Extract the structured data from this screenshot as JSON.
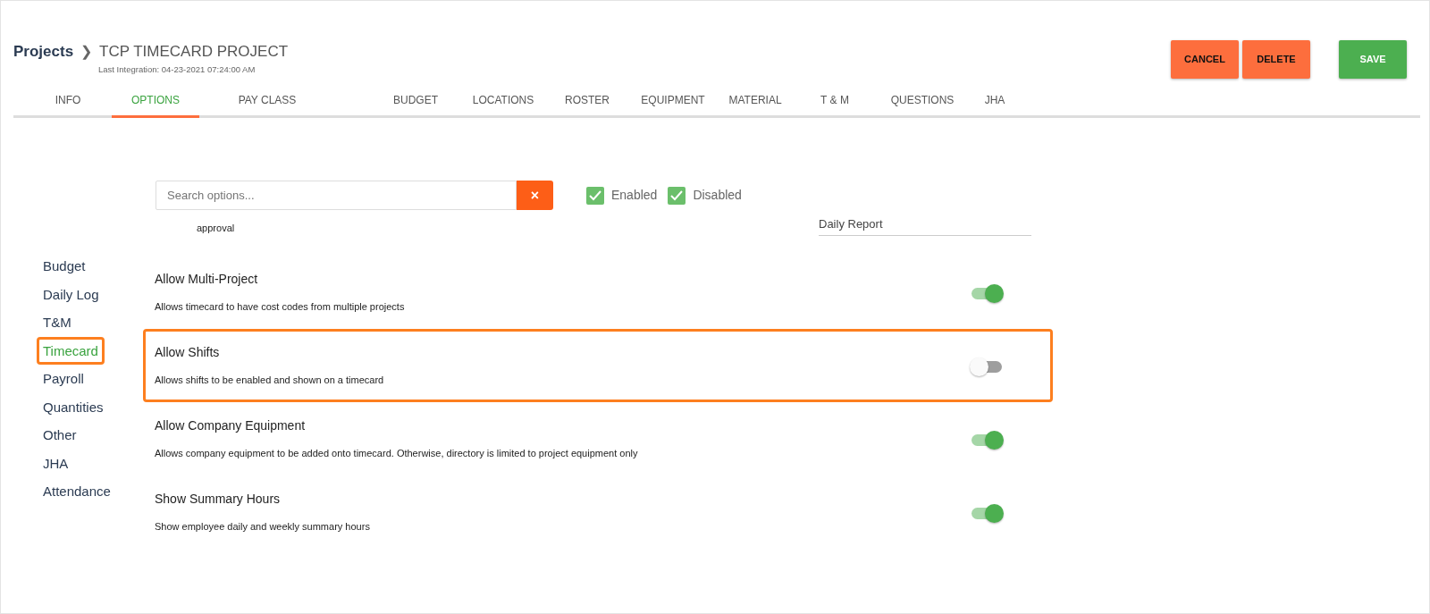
{
  "breadcrumb": {
    "root": "Projects",
    "separator": "❯",
    "project": "TCP TIMECARD PROJECT",
    "subtitle": "Last Integration: 04-23-2021 07:24:00 AM"
  },
  "actions": [
    {
      "label": "CANCEL",
      "kind": "warning"
    },
    {
      "label": "DELETE",
      "kind": "warning"
    },
    {
      "label": "SAVE",
      "kind": "success"
    }
  ],
  "tabs": [
    {
      "label": "INFO",
      "selected": false
    },
    {
      "label": "OPTIONS",
      "selected": true
    },
    {
      "label": "PAY CLASS",
      "selected": false
    },
    {
      "label": "BUDGET",
      "selected": false
    },
    {
      "label": "LOCATIONS",
      "selected": false
    },
    {
      "label": "ROSTER",
      "selected": false
    },
    {
      "label": "EQUIPMENT",
      "selected": false
    },
    {
      "label": "MATERIAL",
      "selected": false
    },
    {
      "label": "T & M",
      "selected": false
    },
    {
      "label": "QUESTIONS",
      "selected": false
    },
    {
      "label": "JHA",
      "selected": false
    }
  ],
  "search": {
    "placeholder": "Search options...",
    "clear": "×"
  },
  "filters": [
    {
      "label": "Enabled",
      "checked": true
    },
    {
      "label": "Disabled",
      "checked": true
    }
  ],
  "sidebar": {
    "items": [
      {
        "label": "Budget",
        "selected": false,
        "highlighted": false
      },
      {
        "label": "Daily Log",
        "selected": false,
        "highlighted": false
      },
      {
        "label": "T&M",
        "selected": false,
        "highlighted": false
      },
      {
        "label": "Timecard",
        "selected": true,
        "highlighted": true
      },
      {
        "label": "Payroll",
        "selected": false,
        "highlighted": false
      },
      {
        "label": "Quantities",
        "selected": false,
        "highlighted": false
      },
      {
        "label": "Other",
        "selected": false,
        "highlighted": false
      },
      {
        "label": "JHA",
        "selected": false,
        "highlighted": false
      },
      {
        "label": "Attendance",
        "selected": false,
        "highlighted": false
      }
    ]
  },
  "partial_option": {
    "description": "approval",
    "field_value": "Daily Report"
  },
  "options": [
    {
      "title": "Allow Multi-Project",
      "description": "Allows timecard to have cost codes from multiple projects",
      "on": true,
      "highlighted": false
    },
    {
      "title": "Allow Shifts",
      "description": "Allows shifts to be enabled and shown on a timecard",
      "on": false,
      "highlighted": true
    },
    {
      "title": "Allow Company Equipment",
      "description": "Allows company equipment to be added onto timecard. Otherwise, directory is limited to project equipment only",
      "on": true,
      "highlighted": false
    },
    {
      "title": "Show Summary Hours",
      "description": "Show employee daily and weekly summary hours",
      "on": true,
      "highlighted": false
    }
  ]
}
